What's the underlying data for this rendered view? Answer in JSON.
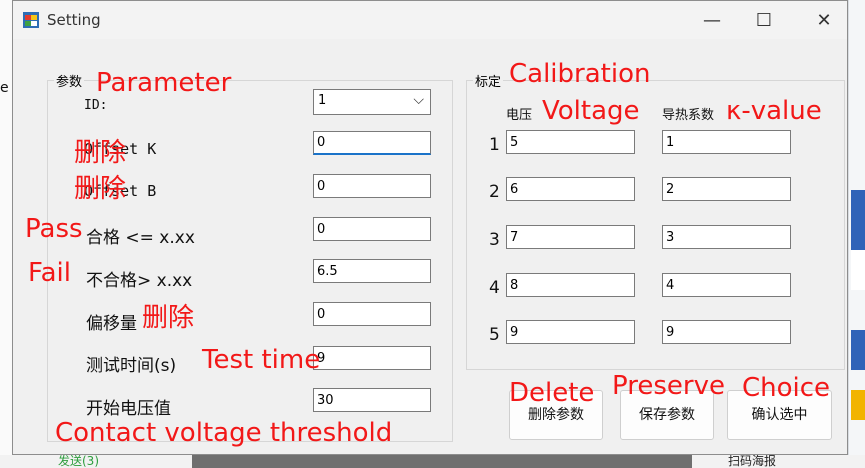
{
  "window": {
    "title": "Setting",
    "minimize": "—",
    "maximize": "☐",
    "close": "✕"
  },
  "parameters": {
    "group_label": "参数",
    "id_label": "ID:",
    "id_value": "1",
    "offset_k_label": "Offset K",
    "offset_k_value": "0",
    "offset_b_label": "Offset B",
    "offset_b_value": "0",
    "pass_label": "合格 <= x.xx",
    "pass_value": "0",
    "fail_label": "不合格>  x.xx",
    "fail_value": "6.5",
    "offset_label": "偏移量",
    "offset_value": "0",
    "test_time_label": "测试时间(s)",
    "test_time_value": "9",
    "start_voltage_label": "开始电压值",
    "start_voltage_value": "30"
  },
  "calibration": {
    "group_label": "标定",
    "voltage_header": "电压",
    "k_header": "导热系数",
    "rows": [
      {
        "index": "1",
        "voltage": "5",
        "k": "1"
      },
      {
        "index": "2",
        "voltage": "6",
        "k": "2"
      },
      {
        "index": "3",
        "voltage": "7",
        "k": "3"
      },
      {
        "index": "4",
        "voltage": "8",
        "k": "4"
      },
      {
        "index": "5",
        "voltage": "9",
        "k": "9"
      }
    ]
  },
  "buttons": {
    "delete": "删除参数",
    "save": "保存参数",
    "confirm": "确认选中"
  },
  "annotations": {
    "parameter": "Parameter",
    "delete_k": "删除",
    "delete_b": "删除",
    "pass": "Pass",
    "fail": "Fail",
    "delete_offset": "删除",
    "test_time": "Test time",
    "contact_voltage": "Contact voltage threshold",
    "calibration": "Calibration",
    "voltage": "Voltage",
    "k_value": "κ-value",
    "delete_btn": "Delete",
    "preserve_btn": "Preserve",
    "choice_btn": "Choice"
  },
  "background": {
    "left_char": "e",
    "bottom_left": "发送(3)",
    "bottom_right": "扫码海报"
  },
  "colors": {
    "annotation": "#f21818",
    "focus": "#1a73c9",
    "window_bg": "#f0f0f0"
  },
  "icons": {
    "app": "winforms-app-icon",
    "dropdown": "chevron-down-icon"
  }
}
